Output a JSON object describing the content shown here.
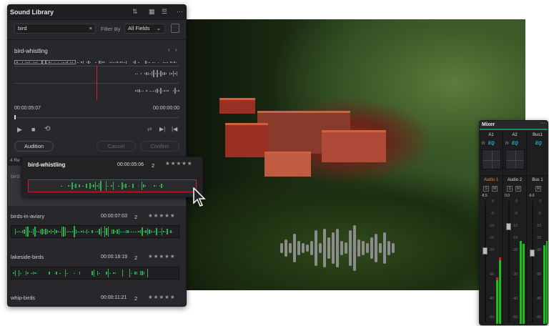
{
  "library": {
    "title": "Sound Library",
    "icons": [
      "sort-icon",
      "grid-view-icon",
      "list-view-icon",
      "more-icon"
    ],
    "search": {
      "value": "bird",
      "clear": "×"
    },
    "filter_label": "Filter By",
    "filter_value": "All Fields",
    "preview": {
      "name": "bird-whistling",
      "current_time": "00:00:05:07",
      "end_time": "00:00:00:00"
    },
    "buttons": {
      "audition": "Audition",
      "cancel": "Cancel",
      "confirm": "Confirm"
    },
    "results_count": "4 Re",
    "results": [
      {
        "name": "bird",
        "duration": "",
        "channels": ""
      },
      {
        "name": "birds-in-aviary",
        "duration": "00:00:07:03",
        "channels": "2",
        "stars": "★★★★★"
      },
      {
        "name": "lakeside-birds",
        "duration": "00:00:18:19",
        "channels": "2",
        "stars": "★★★★★"
      },
      {
        "name": "whip-birds",
        "duration": "00:00:11:21",
        "channels": "2",
        "stars": "★★★★★"
      }
    ]
  },
  "popup": {
    "name": "bird-whistling",
    "duration": "00:00:05:06",
    "channels": "2",
    "stars": "★★★★★"
  },
  "mixer": {
    "title": "Mixer",
    "channels": [
      {
        "id": "A1",
        "fx": "fx",
        "eq": "EQ",
        "track": "Audio 1",
        "buttons": [
          "S",
          "M"
        ],
        "level": "-8.5",
        "active": true
      },
      {
        "id": "A2",
        "fx": "fx",
        "eq": "EQ",
        "track": "Audio 2",
        "buttons": [
          "S",
          "M"
        ],
        "level": "0.0"
      },
      {
        "id": "Bus1",
        "eq": "EQ",
        "track": "Bus 1",
        "buttons": [
          "M"
        ],
        "level": "-9.6"
      }
    ],
    "scale": [
      "0",
      "-5",
      "-10",
      "-15",
      "-20",
      "-30",
      "-40",
      "-50"
    ]
  },
  "colors": {
    "accent_red": "#d02030",
    "wave_green": "#2fb050",
    "track_active": "#e08a2a",
    "eq_cyan": "#20c0d0"
  }
}
